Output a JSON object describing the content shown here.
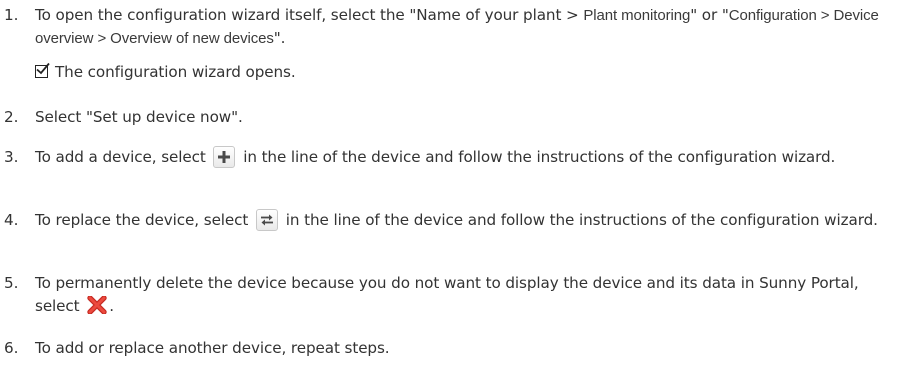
{
  "steps": [
    {
      "num": "1.",
      "text_a": "To open the configuration wizard itself, select the \"Name of your plant > ",
      "path_a": "Plant monitoring",
      "text_b": "\" or \"",
      "path_b": "Configuration > Device overview > Overview of new devices",
      "text_c": "\".",
      "result": "The configuration wizard opens."
    },
    {
      "num": "2.",
      "text": "Select \"Set up device now\"."
    },
    {
      "num": "3.",
      "text_a": "To add a device, select",
      "text_b": "in the line of the device and follow the instructions of the configuration wizard.",
      "icon": "plus-icon"
    },
    {
      "num": "4.",
      "text_a": "To replace the device, select",
      "text_b": "in the line of the device and follow the instructions of the configuration wizard.",
      "icon": "replace-arrows-icon"
    },
    {
      "num": "5.",
      "text_a": "To permanently delete the device because you do not want to display the device and its data in Sunny Portal, select",
      "text_b": ".",
      "icon": "delete-x-icon"
    },
    {
      "num": "6.",
      "text": "To add or replace another device, repeat steps."
    }
  ],
  "colors": {
    "text": "#333333",
    "delete_red": "#e4332a",
    "icon_dark": "#4a4a4a"
  }
}
